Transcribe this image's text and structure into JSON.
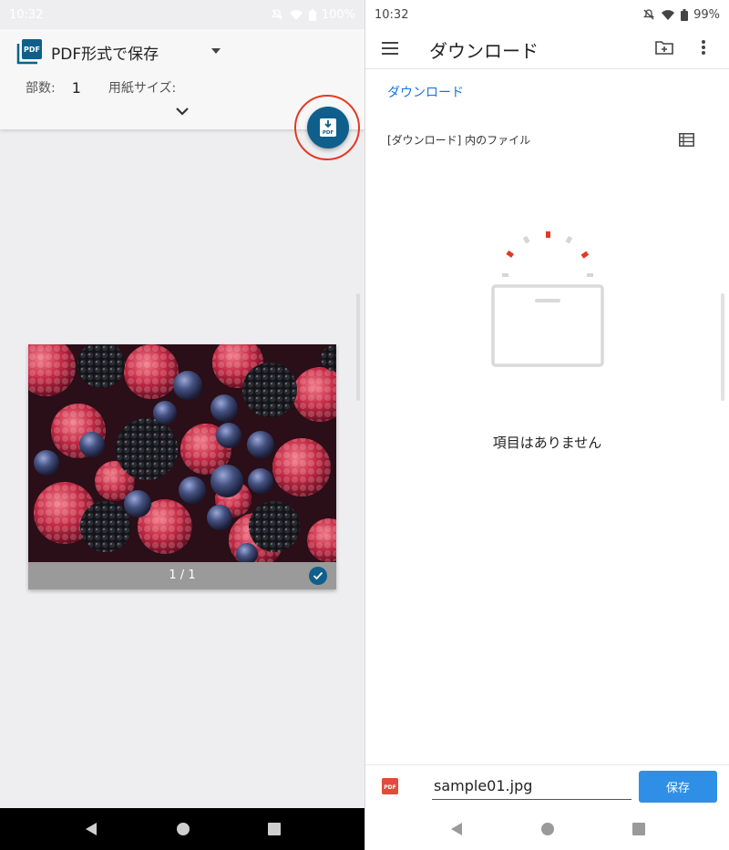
{
  "left": {
    "status": {
      "time": "10:32",
      "battery": "100%"
    },
    "header": {
      "destination_label": "PDF形式で保存",
      "copies_label": "部数:",
      "copies_value": "1",
      "paper_size_label": "用紙サイズ:"
    },
    "preview": {
      "page_indicator": "1 / 1"
    }
  },
  "right": {
    "status": {
      "time": "10:32",
      "battery": "99%"
    },
    "appbar": {
      "title": "ダウンロード"
    },
    "breadcrumb": "ダウンロード",
    "section_label": "[ダウンロード] 内のファイル",
    "empty_message": "項目はありません",
    "savebar": {
      "filename": "sample01.jpg",
      "save_label": "保存"
    }
  },
  "colors": {
    "fab": "#0e5f8c",
    "highlight_ring": "#e23a22",
    "accent_blue": "#1a73e8",
    "save_button": "#2f8fe6"
  },
  "icons": [
    "pdf-logo-icon",
    "dropdown-caret-icon",
    "chevron-down-icon",
    "pdf-download-icon",
    "check-icon",
    "menu-icon",
    "new-folder-icon",
    "more-vert-icon",
    "list-view-icon",
    "pdf-file-icon",
    "back-icon",
    "home-icon",
    "recents-icon"
  ]
}
